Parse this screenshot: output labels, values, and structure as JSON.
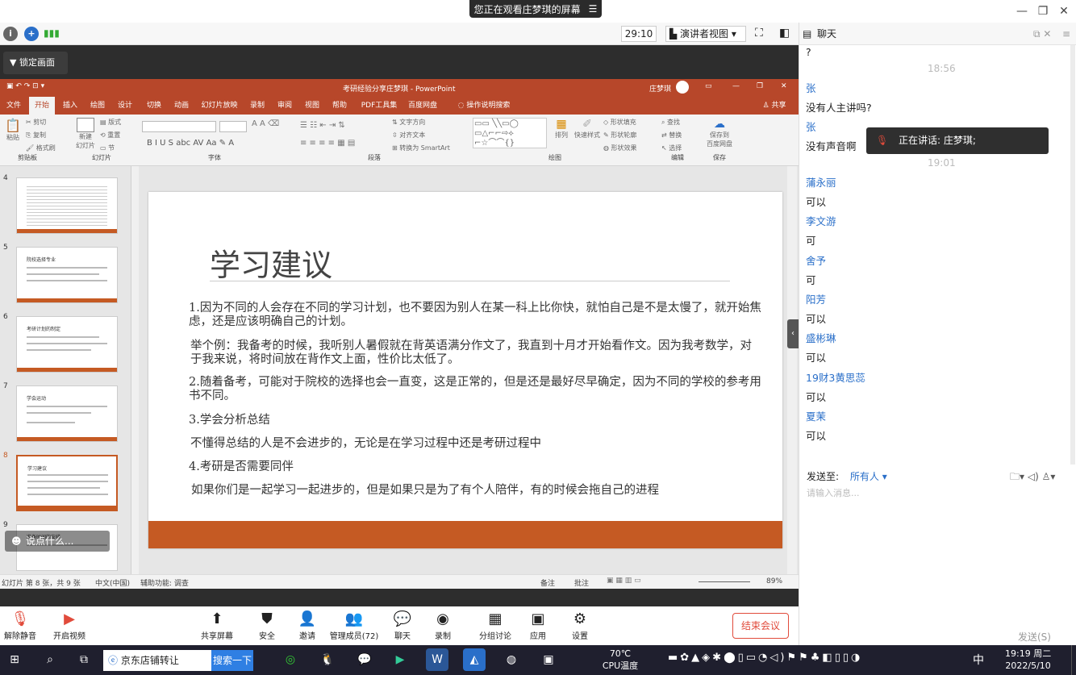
{
  "share_banner": {
    "text": "您正在观看庄梦琪的屏幕",
    "menu_icon": "menu-icon"
  },
  "meeting_toolbar": {
    "timer": "29:10",
    "view_label": "演讲者视图"
  },
  "lock_screen": "锁定画面",
  "ppt": {
    "title": "考研经验分享庄梦琪 - PowerPoint",
    "user": "庄梦琪",
    "tabs": [
      "文件",
      "开始",
      "插入",
      "绘图",
      "设计",
      "切换",
      "动画",
      "幻灯片放映",
      "录制",
      "审阅",
      "视图",
      "帮助",
      "PDF工具集",
      "百度网盘"
    ],
    "tell_me": "操作说明搜索",
    "share": "共享",
    "ribbon": {
      "clipboard": {
        "paste": "粘贴",
        "cut": "剪切",
        "copy": "复制",
        "painter": "格式刷",
        "group": "剪贴板"
      },
      "slides": {
        "new": "新建\n幻灯片",
        "layout": "版式",
        "reset": "重置",
        "section": "节",
        "group": "幻灯片"
      },
      "font_group": "字体",
      "paragraph": {
        "dir": "文字方向",
        "align": "对齐文本",
        "smartart": "转换为 SmartArt",
        "group": "段落"
      },
      "drawing": {
        "arrange": "排列",
        "styles": "快速样式",
        "fill": "形状填充",
        "outline": "形状轮廓",
        "effects": "形状效果",
        "group": "绘图"
      },
      "editing": {
        "find": "查找",
        "replace": "替换",
        "select": "选择",
        "group": "编辑"
      },
      "save": {
        "label": "保存到\n百度网盘",
        "group": "保存"
      }
    },
    "thumb_numbers": [
      "4",
      "5",
      "6",
      "7",
      "8",
      "9"
    ],
    "thumb_titles": [
      "",
      "院校选择专业",
      "考研计划的制定",
      "学会运动",
      "学习建议",
      "准备时间的安排"
    ],
    "slide": {
      "title": "学习建议",
      "paragraphs": [
        "1.因为不同的人会存在不同的学习计划，也不要因为别人在某一科上比你快，就怕自己是不是太慢了，就开始焦虑，还是应该明确自己的计划。",
        "举个例：我备考的时候，我听别人暑假就在背英语满分作文了，我直到十月才开始看作文。因为我考数学，对于我来说，将时间放在背作文上面，性价比太低了。",
        "2.随着备考，可能对于院校的选择也会一直变，这是正常的，但是还是最好尽早确定，因为不同的学校的参考用书不同。",
        "3.学会分析总结",
        "不懂得总结的人是不会进步的，无论是在学习过程中还是考研过程中",
        "4.考研是否需要同伴",
        "如果你们是一起学习一起进步的，但是如果只是为了有个人陪伴，有的时候会拖自己的进程"
      ]
    },
    "say_something": "说点什么...",
    "status": {
      "slide_of": "幻灯片 第 8 张，共 9 张",
      "lang": "中文(中国)",
      "accessibility": "辅助功能: 调查",
      "notes": "备注",
      "comments": "批注",
      "zoom": "89%"
    }
  },
  "bottom": {
    "mute": "解除静音",
    "video": "开启视频",
    "share_screen": "共享屏幕",
    "security": "安全",
    "invite": "邀请",
    "members": "管理成员(72)",
    "chat": "聊天",
    "record": "录制",
    "breakout": "分组讨论",
    "apps": "应用",
    "settings": "设置",
    "end": "结束会议",
    "send": "发送(S)"
  },
  "chat": {
    "title": "聊天",
    "messages": [
      {
        "type": "text",
        "text": "?"
      },
      {
        "type": "time",
        "text": "18:56"
      },
      {
        "type": "name",
        "text": "张"
      },
      {
        "type": "text",
        "text": "没有人主讲吗?"
      },
      {
        "type": "name",
        "text": "张"
      },
      {
        "type": "text",
        "text": "没有声音啊"
      },
      {
        "type": "time",
        "text": "19:01"
      },
      {
        "type": "name",
        "text": "蒲永丽"
      },
      {
        "type": "text",
        "text": "可以"
      },
      {
        "type": "name",
        "text": "李文游"
      },
      {
        "type": "text",
        "text": "可"
      },
      {
        "type": "name",
        "text": "舍予"
      },
      {
        "type": "text",
        "text": "可"
      },
      {
        "type": "name",
        "text": "阳芳"
      },
      {
        "type": "text",
        "text": "可以"
      },
      {
        "type": "name",
        "text": "盛彬琳"
      },
      {
        "type": "text",
        "text": "可以"
      },
      {
        "type": "name",
        "text": "19财3黄思蕊"
      },
      {
        "type": "text",
        "text": "可以"
      },
      {
        "type": "name",
        "text": "夏茉"
      },
      {
        "type": "text",
        "text": "可以"
      }
    ],
    "speaker_tip": "正在讲话: 庄梦琪;",
    "send_to_label": "发送至:",
    "send_to_value": "所有人",
    "input_placeholder": "请输入消息..."
  },
  "taskbar": {
    "search_text": "京东店铺转让",
    "search_btn": "搜索一下",
    "temp": "70℃",
    "temp_label": "CPU温度",
    "ime": "中",
    "time": "19:19 周二",
    "date": "2022/5/10"
  },
  "colors": {
    "ppt_accent": "#b7472a",
    "slide_band": "#c55a23",
    "chat_name": "#2a6fc9",
    "end_red": "#e14b3b"
  }
}
